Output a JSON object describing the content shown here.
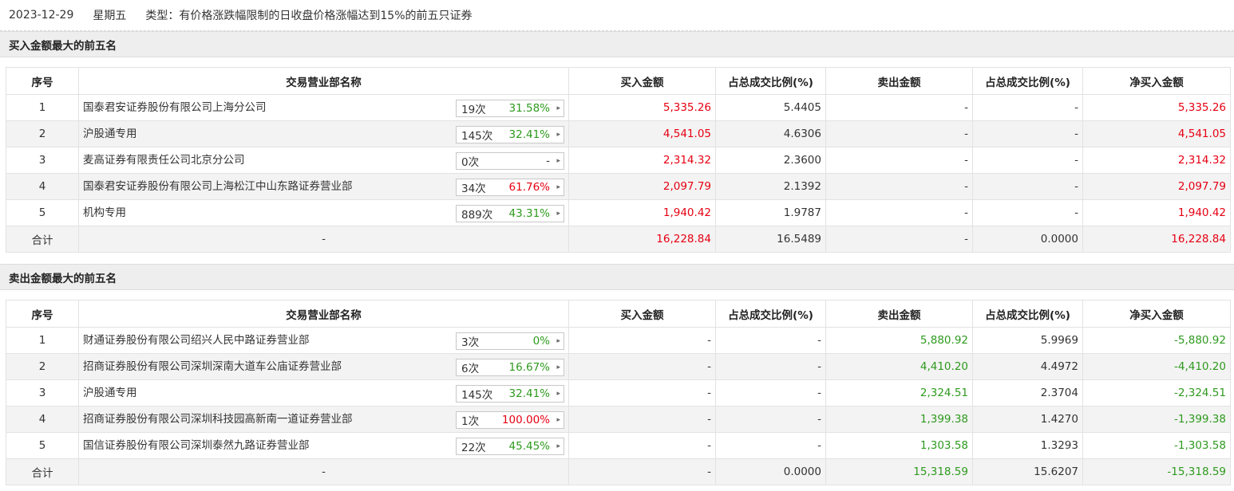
{
  "header": {
    "date": "2023-12-29",
    "weekday": "星期五",
    "type_text": "类型：有价格涨跌幅限制的日收盘价格涨幅达到15%的前五只证券"
  },
  "columns": [
    "序号",
    "交易营业部名称",
    "买入金额",
    "占总成交比例(%)",
    "卖出金额",
    "占总成交比例(%)",
    "净买入金额"
  ],
  "colors": {
    "up": "#e60012",
    "down": "#2e9a1e",
    "neutral": "#333333"
  },
  "buy_section": {
    "title": "买入金额最大的前五名",
    "rows": [
      {
        "no": "1",
        "name": "国泰君安证券股份有限公司上海分公司",
        "times": "19次",
        "pct": "31.58%",
        "pct_color": "down",
        "buy": "5,335.26",
        "buy_ratio": "5.4405",
        "sell": "-",
        "sell_ratio": "-",
        "net": "5,335.26",
        "net_color": "up"
      },
      {
        "no": "2",
        "name": "沪股通专用",
        "times": "145次",
        "pct": "32.41%",
        "pct_color": "down",
        "buy": "4,541.05",
        "buy_ratio": "4.6306",
        "sell": "-",
        "sell_ratio": "-",
        "net": "4,541.05",
        "net_color": "up"
      },
      {
        "no": "3",
        "name": "麦高证券有限责任公司北京分公司",
        "times": "0次",
        "pct": "-",
        "pct_color": "neutral",
        "buy": "2,314.32",
        "buy_ratio": "2.3600",
        "sell": "-",
        "sell_ratio": "-",
        "net": "2,314.32",
        "net_color": "up"
      },
      {
        "no": "4",
        "name": "国泰君安证券股份有限公司上海松江中山东路证券营业部",
        "times": "34次",
        "pct": "61.76%",
        "pct_color": "up",
        "buy": "2,097.79",
        "buy_ratio": "2.1392",
        "sell": "-",
        "sell_ratio": "-",
        "net": "2,097.79",
        "net_color": "up"
      },
      {
        "no": "5",
        "name": "机构专用",
        "times": "889次",
        "pct": "43.31%",
        "pct_color": "down",
        "buy": "1,940.42",
        "buy_ratio": "1.9787",
        "sell": "-",
        "sell_ratio": "-",
        "net": "1,940.42",
        "net_color": "up"
      }
    ],
    "total": {
      "label": "合计",
      "name": "-",
      "buy": "16,228.84",
      "buy_ratio": "16.5489",
      "sell": "-",
      "sell_ratio": "0.0000",
      "net": "16,228.84"
    }
  },
  "sell_section": {
    "title": "卖出金额最大的前五名",
    "rows": [
      {
        "no": "1",
        "name": "财通证券股份有限公司绍兴人民中路证券营业部",
        "times": "3次",
        "pct": "0%",
        "pct_color": "down",
        "buy": "-",
        "buy_ratio": "-",
        "sell": "5,880.92",
        "sell_ratio": "5.9969",
        "net": "-5,880.92",
        "net_color": "down"
      },
      {
        "no": "2",
        "name": "招商证券股份有限公司深圳深南大道车公庙证券营业部",
        "times": "6次",
        "pct": "16.67%",
        "pct_color": "down",
        "buy": "-",
        "buy_ratio": "-",
        "sell": "4,410.20",
        "sell_ratio": "4.4972",
        "net": "-4,410.20",
        "net_color": "down"
      },
      {
        "no": "3",
        "name": "沪股通专用",
        "times": "145次",
        "pct": "32.41%",
        "pct_color": "down",
        "buy": "-",
        "buy_ratio": "-",
        "sell": "2,324.51",
        "sell_ratio": "2.3704",
        "net": "-2,324.51",
        "net_color": "down"
      },
      {
        "no": "4",
        "name": "招商证券股份有限公司深圳科技园高新南一道证券营业部",
        "times": "1次",
        "pct": "100.00%",
        "pct_color": "up",
        "buy": "-",
        "buy_ratio": "-",
        "sell": "1,399.38",
        "sell_ratio": "1.4270",
        "net": "-1,399.38",
        "net_color": "down"
      },
      {
        "no": "5",
        "name": "国信证券股份有限公司深圳泰然九路证券营业部",
        "times": "22次",
        "pct": "45.45%",
        "pct_color": "down",
        "buy": "-",
        "buy_ratio": "-",
        "sell": "1,303.58",
        "sell_ratio": "1.3293",
        "net": "-1,303.58",
        "net_color": "down"
      }
    ],
    "total": {
      "label": "合计",
      "name": "-",
      "buy": "-",
      "buy_ratio": "0.0000",
      "sell": "15,318.59",
      "sell_ratio": "15.6207",
      "net": "-15,318.59"
    }
  }
}
